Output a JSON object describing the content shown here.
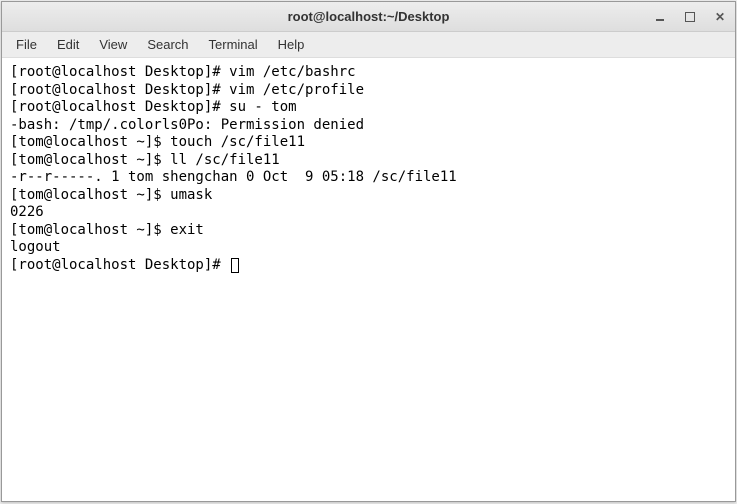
{
  "titlebar": {
    "title": "root@localhost:~/Desktop"
  },
  "menubar": {
    "items": [
      {
        "label": "File"
      },
      {
        "label": "Edit"
      },
      {
        "label": "View"
      },
      {
        "label": "Search"
      },
      {
        "label": "Terminal"
      },
      {
        "label": "Help"
      }
    ]
  },
  "terminal": {
    "lines": [
      "[root@localhost Desktop]# vim /etc/bashrc",
      "[root@localhost Desktop]# vim /etc/profile",
      "[root@localhost Desktop]# su - tom",
      "-bash: /tmp/.colorls0Po: Permission denied",
      "[tom@localhost ~]$ touch /sc/file11",
      "[tom@localhost ~]$ ll /sc/file11",
      "-r--r-----. 1 tom shengchan 0 Oct  9 05:18 /sc/file11",
      "[tom@localhost ~]$ umask",
      "0226",
      "[tom@localhost ~]$ exit",
      "logout",
      "[root@localhost Desktop]# "
    ]
  }
}
